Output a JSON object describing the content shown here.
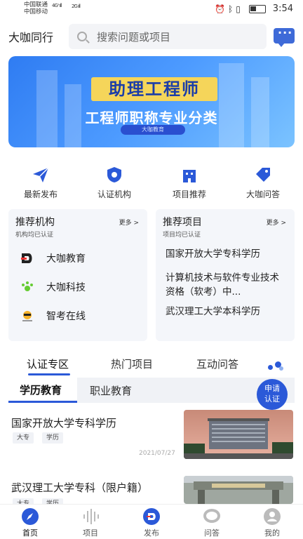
{
  "status": {
    "carrier1": "中国联通",
    "carrier2": "中国移动",
    "net1": "4G⁺ıll",
    "net2": "2G ıll",
    "time": "3:54"
  },
  "header": {
    "brand": "大咖同行",
    "search_placeholder": "搜索问题或项目"
  },
  "banner": {
    "title": "助理工程师",
    "subtitle": "工程师职称专业分类",
    "pill": "大咖教育"
  },
  "quick_nav": [
    {
      "label": "最新发布",
      "icon": "paper-plane-icon"
    },
    {
      "label": "认证机构",
      "icon": "shield-icon"
    },
    {
      "label": "项目推荐",
      "icon": "building-icon"
    },
    {
      "label": "大咖问答",
      "icon": "tag-icon"
    }
  ],
  "institutions": {
    "title": "推荐机构",
    "subtitle": "机构均已认证",
    "more": "更多 >",
    "items": [
      {
        "name": "大咖教育",
        "logo_color": "#e33"
      },
      {
        "name": "大咖科技",
        "logo_color": "#6c3"
      },
      {
        "name": "智考在线",
        "logo_color": "#f5b22a"
      }
    ]
  },
  "projects": {
    "title": "推荐项目",
    "subtitle": "项目均已认证",
    "more": "更多 >",
    "items": [
      "国家开放大学专科学历",
      "计算机技术与软件专业技术资格（软考）中...",
      "武汉理工大学本科学历"
    ]
  },
  "tabs": [
    "认证专区",
    "热门项目",
    "互动问答"
  ],
  "subtabs": [
    "学历教育",
    "职业教育"
  ],
  "apply_label": "申请\n认证",
  "apply_line1": "申请",
  "apply_line2": "认证",
  "articles": [
    {
      "title": "国家开放大学专科学历",
      "tags": [
        "大专",
        "学历"
      ],
      "date": "2021/07/27"
    },
    {
      "title": "武汉理工大学专科（限户籍）",
      "tags": [
        "大专",
        "学历"
      ],
      "date": ""
    }
  ],
  "bottom_nav": [
    {
      "label": "首页",
      "icon": "compass-icon",
      "active": true
    },
    {
      "label": "项目",
      "icon": "soundwave-icon",
      "active": false
    },
    {
      "label": "发布",
      "icon": "publish-icon",
      "active": false
    },
    {
      "label": "问答",
      "icon": "speech-bubble-icon",
      "active": false
    },
    {
      "label": "我的",
      "icon": "user-icon",
      "active": false
    }
  ],
  "colors": {
    "accent": "#2b59d8",
    "banner": "#3a86f6",
    "panel_bg": "#f4f6fa"
  }
}
